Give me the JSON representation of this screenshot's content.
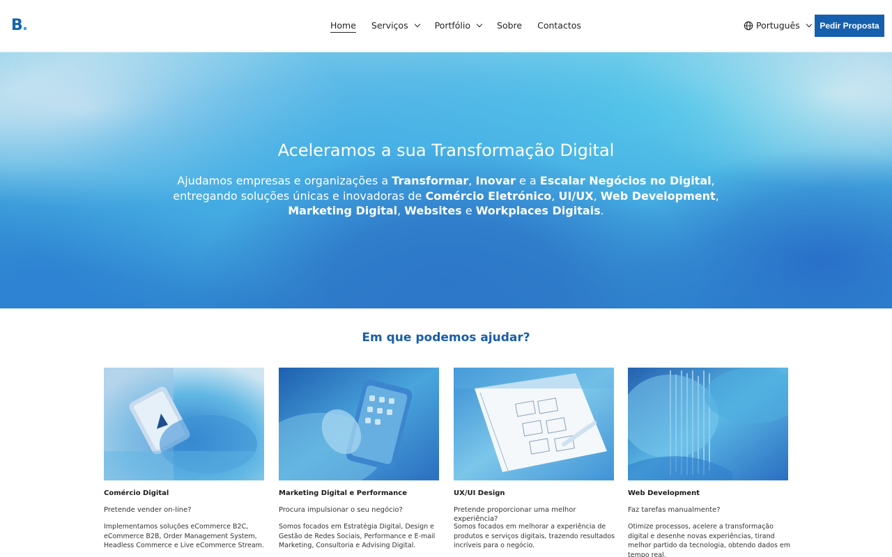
{
  "header": {
    "logo_text": "B",
    "logo_dot": ".",
    "nav": [
      {
        "label": "Home",
        "active": true,
        "has_dropdown": false
      },
      {
        "label": "Serviços",
        "active": false,
        "has_dropdown": true
      },
      {
        "label": "Portfólio",
        "active": false,
        "has_dropdown": true
      },
      {
        "label": "Sobre",
        "active": false,
        "has_dropdown": false
      },
      {
        "label": "Contactos",
        "active": false,
        "has_dropdown": false
      }
    ],
    "language": "Português",
    "cta_label": "Pedir Proposta"
  },
  "hero": {
    "title": "Aceleramos a sua Transformação Digital",
    "subtitle_parts": [
      {
        "text": "Ajudamos empresas e organizações a ",
        "bold": false
      },
      {
        "text": "Transformar",
        "bold": true
      },
      {
        "text": ", ",
        "bold": false
      },
      {
        "text": "Inovar",
        "bold": true
      },
      {
        "text": " e a ",
        "bold": false
      },
      {
        "text": "Escalar Negócios no Digital",
        "bold": true
      },
      {
        "text": ", entregando soluções únicas e inovadoras de ",
        "bold": false
      },
      {
        "text": "Comércio Eletrónico",
        "bold": true
      },
      {
        "text": ", ",
        "bold": false
      },
      {
        "text": "UI/UX",
        "bold": true
      },
      {
        "text": ", ",
        "bold": false
      },
      {
        "text": "Web Development",
        "bold": true
      },
      {
        "text": ", ",
        "bold": false
      },
      {
        "text": "Marketing Digital",
        "bold": true
      },
      {
        "text": ", ",
        "bold": false
      },
      {
        "text": "Websites",
        "bold": true
      },
      {
        "text": " e ",
        "bold": false
      },
      {
        "text": "Workplaces Digitais",
        "bold": true
      },
      {
        "text": ".",
        "bold": false
      }
    ]
  },
  "services": {
    "title": "Em que podemos ajudar?",
    "cards": [
      {
        "title": "Comércio Digital",
        "question": "Pretende vender on-line?",
        "description": "Implementamos soluções eCommerce B2C, eCommerce B2B, Order Management System, Headless Commerce e Live eCommerce Stream.",
        "image": "phone-shopping-image"
      },
      {
        "title": "Marketing Digital e Performance",
        "question": "Procura impulsionar o seu negócio?",
        "description": "Somos focados em Estratégia Digital, Design e Gestão de Redes Sociais, Performance e E-mail Marketing, Consultoria e Advising Digital.",
        "image": "social-media-phone-image"
      },
      {
        "title": "UX/UI Design",
        "question": "Pretende proporcionar uma melhor experiência?",
        "description": "Somos focados em melhorar a experiência de produtos e serviços digitais, trazendo resultados incríveis para o negócio.",
        "image": "wireframe-notebook-image"
      },
      {
        "title": "Web Development",
        "question": "Faz tarefas manualmente?",
        "description": "Otimize processos, acelere a transformação digital e desenhe novas experiências, tirand melhor partido da tecnologia, obtendo dados em tempo real.",
        "image": "code-data-image"
      }
    ]
  },
  "colors": {
    "brand_blue": "#1560ae",
    "section_title": "#1a5ea8"
  }
}
